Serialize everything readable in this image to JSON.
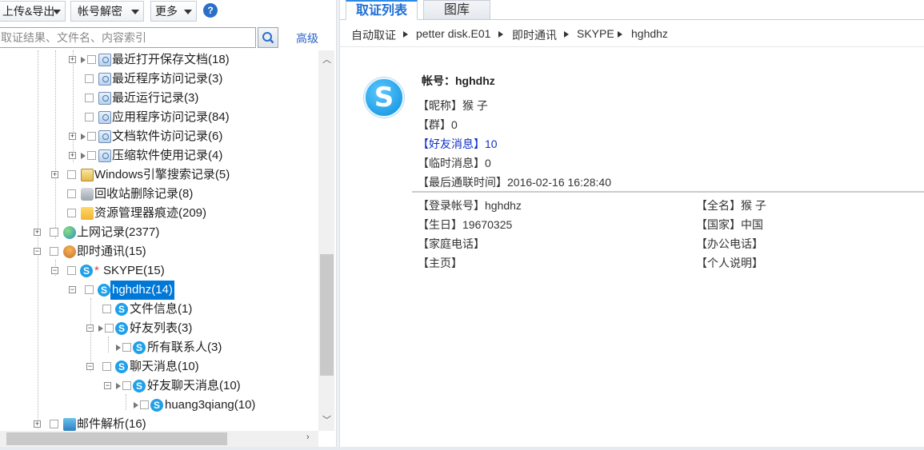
{
  "toolbar": {
    "upload_export": "上传&导出",
    "account_decrypt": "帐号解密",
    "more": "更多",
    "help": "?"
  },
  "search": {
    "placeholder": "取证结果、文件名、内容索引",
    "advanced": "高级"
  },
  "tree": [
    {
      "label": "最近打开保存文档(18)",
      "icon": "document-icon"
    },
    {
      "label": "最近程序访问记录(3)",
      "icon": "document-icon"
    },
    {
      "label": "最近运行记录(3)",
      "icon": "document-icon"
    },
    {
      "label": "应用程序访问记录(84)",
      "icon": "document-icon"
    },
    {
      "label": "文档软件访问记录(6)",
      "icon": "document-icon"
    },
    {
      "label": "压缩软件使用记录(4)",
      "icon": "document-icon"
    },
    {
      "label": "Windows引擎搜索记录(5)",
      "icon": "windows-search-icon"
    },
    {
      "label": "回收站删除记录(8)",
      "icon": "recycle-bin-icon"
    },
    {
      "label": "资源管理器痕迹(209)",
      "icon": "folder-icon"
    },
    {
      "label": "上网记录(2377)",
      "icon": "globe-icon"
    },
    {
      "label": "即时通讯(15)",
      "icon": "people-icon"
    },
    {
      "label": "SKYPE(15)",
      "icon": "skype-icon",
      "marker": "*"
    },
    {
      "label": "hghdhz(14)",
      "icon": "skype-icon"
    },
    {
      "label": "文件信息(1)",
      "icon": "skype-icon"
    },
    {
      "label": "好友列表(3)",
      "icon": "skype-icon"
    },
    {
      "label": "所有联系人(3)",
      "icon": "skype-icon"
    },
    {
      "label": "聊天消息(10)",
      "icon": "skype-icon"
    },
    {
      "label": "好友聊天消息(10)",
      "icon": "skype-icon"
    },
    {
      "label": "huang3qiang(10)",
      "icon": "skype-icon"
    },
    {
      "label": "邮件解析(16)",
      "icon": "mail-icon"
    }
  ],
  "tabs": {
    "active": "取证列表",
    "inactive": "图库"
  },
  "breadcrumb": [
    "自动取证",
    "petter disk.E01",
    "即时通讯",
    "SKYPE",
    "hghdhz"
  ],
  "detail": {
    "account": "帐号：hghdhz",
    "nickname": "【昵称】猴 子",
    "group": "【群】0",
    "friend_msg": "【好友消息】10",
    "temp_msg": "【临时消息】0",
    "last_contact": "【最后通联时间】2016-02-16 16:28:40",
    "login_account": "【登录帐号】hghdhz",
    "birthday": "【生日】19670325",
    "home_phone": "【家庭电话】",
    "homepage": "【主页】",
    "full_name": "【全名】猴 子",
    "country": "【国家】中国",
    "office_phone": "【办公电话】",
    "personal_note": "【个人说明】"
  },
  "colors": {
    "selection": "#0078d7",
    "tab_active": "#1e6ed6",
    "friend_msg": "#1030c8",
    "skype": "#1fa0e8"
  }
}
